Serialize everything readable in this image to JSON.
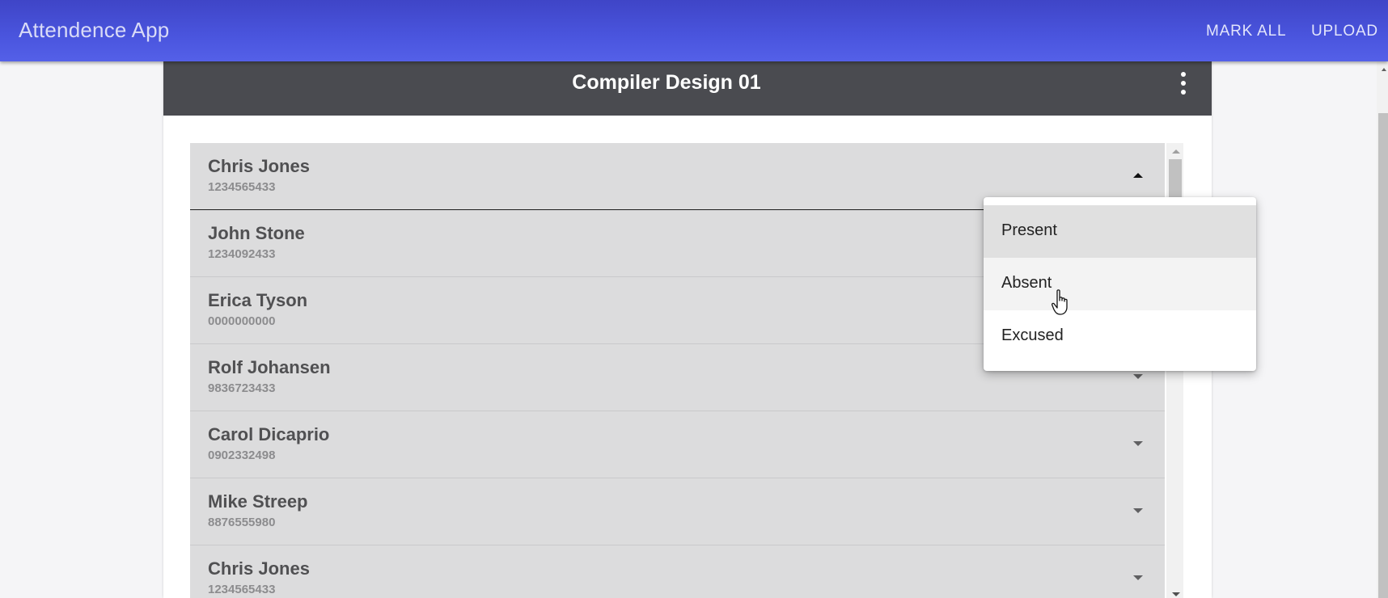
{
  "app_bar": {
    "title": "Attendence App",
    "actions": [
      "MARK ALL",
      "UPLOAD"
    ]
  },
  "card": {
    "title": "Compiler Design 01",
    "menu_icon": "more-vert-icon"
  },
  "students": [
    {
      "name": "Chris Jones",
      "id": "1234565433",
      "expanded": true
    },
    {
      "name": "John Stone",
      "id": "1234092433"
    },
    {
      "name": "Erica Tyson",
      "id": "0000000000"
    },
    {
      "name": "Rolf Johansen",
      "id": "9836723433"
    },
    {
      "name": "Carol Dicaprio",
      "id": "0902332498"
    },
    {
      "name": "Mike Streep",
      "id": "8876555980"
    },
    {
      "name": "Chris Jones",
      "id": "1234565433"
    }
  ],
  "status_menu": {
    "options": [
      "Present",
      "Absent",
      "Excused"
    ],
    "selected": "Present",
    "hovered": "Absent"
  },
  "colors": {
    "app_bar": "#4a55de",
    "card_header": "#4a4b50",
    "list_item": "#dcdcdd"
  }
}
